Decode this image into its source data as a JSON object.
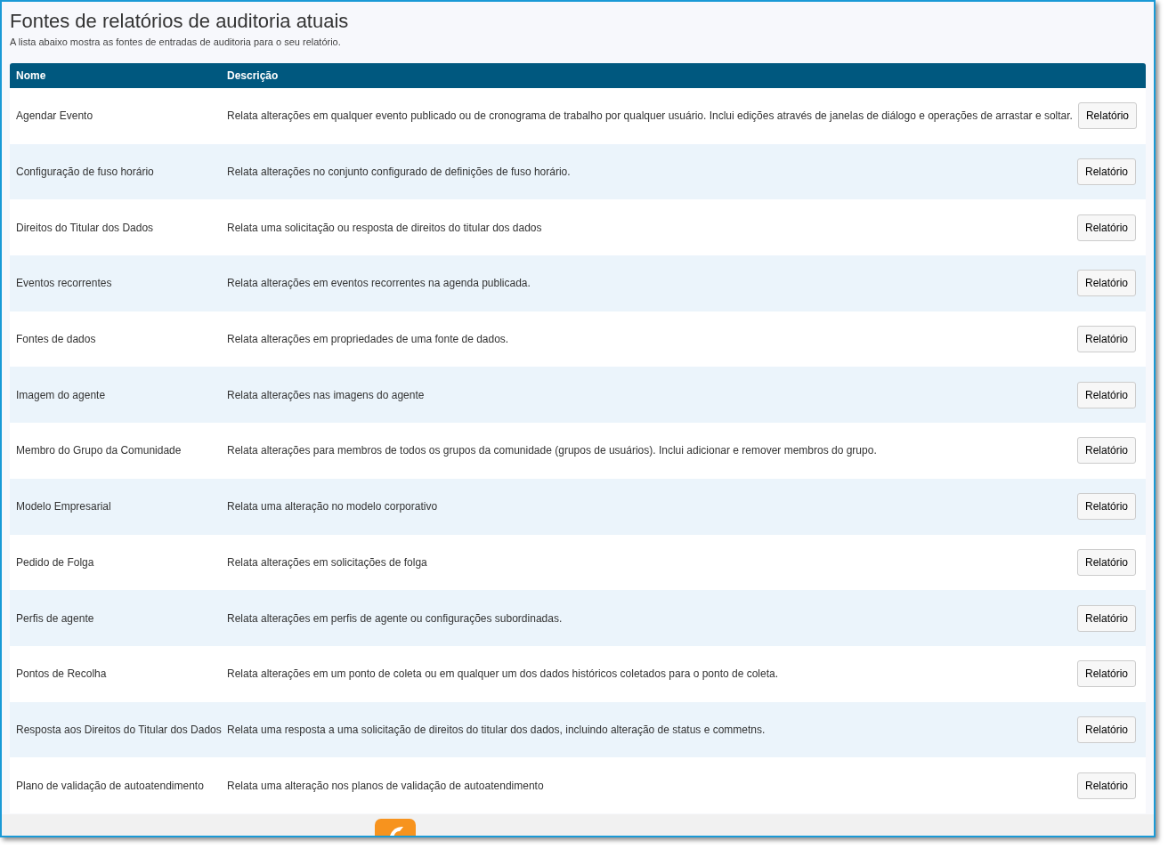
{
  "title": "Fontes de relatórios de auditoria atuais",
  "subtitle": "A lista abaixo mostra as fontes de entradas de auditoria para o seu relatório.",
  "table": {
    "columns": [
      "Nome",
      "Descrição"
    ],
    "rows": [
      {
        "name": "Agendar Evento",
        "description": "Relata alterações em qualquer evento publicado ou de cronograma de trabalho por qualquer usuário. Inclui edições através de janelas de diálogo e operações de arrastar e soltar.",
        "button": "Relatório"
      },
      {
        "name": "Configuração de fuso horário",
        "description": "Relata alterações no conjunto configurado de definições de fuso horário.",
        "button": "Relatório"
      },
      {
        "name": "Direitos do Titular dos Dados",
        "description": "Relata uma solicitação ou resposta de direitos do titular dos dados",
        "button": "Relatório"
      },
      {
        "name": "Eventos recorrentes",
        "description": "Relata alterações em eventos recorrentes na agenda publicada.",
        "button": "Relatório"
      },
      {
        "name": "Fontes de dados",
        "description": "Relata alterações em propriedades de uma fonte de dados.",
        "button": "Relatório"
      },
      {
        "name": "Imagem do agente",
        "description": "Relata alterações nas imagens do agente",
        "button": "Relatório"
      },
      {
        "name": "Membro do Grupo da Comunidade",
        "description": "Relata alterações para membros de todos os grupos da comunidade (grupos de usuários). Inclui adicionar e remover membros do grupo.",
        "button": "Relatório"
      },
      {
        "name": "Modelo Empresarial",
        "description": "Relata uma alteração no modelo corporativo",
        "button": "Relatório"
      },
      {
        "name": "Pedido de Folga",
        "description": "Relata alterações em solicitações de folga",
        "button": "Relatório"
      },
      {
        "name": "Perfis de agente",
        "description": "Relata alterações em perfis de agente ou configurações subordinadas.",
        "button": "Relatório"
      },
      {
        "name": "Pontos de Recolha",
        "description": "Relata alterações em um ponto de coleta ou em qualquer um dos dados históricos coletados para o ponto de coleta.",
        "button": "Relatório"
      },
      {
        "name": "Resposta aos Direitos do Titular dos Dados",
        "description": "Relata uma resposta a uma solicitação de direitos do titular dos dados, incluindo alteração de status e commetns.",
        "button": "Relatório"
      },
      {
        "name": "Plano de validação de autoatendimento",
        "description": "Relata uma alteração nos planos de validação de autoatendimento",
        "button": "Relatório"
      }
    ]
  }
}
